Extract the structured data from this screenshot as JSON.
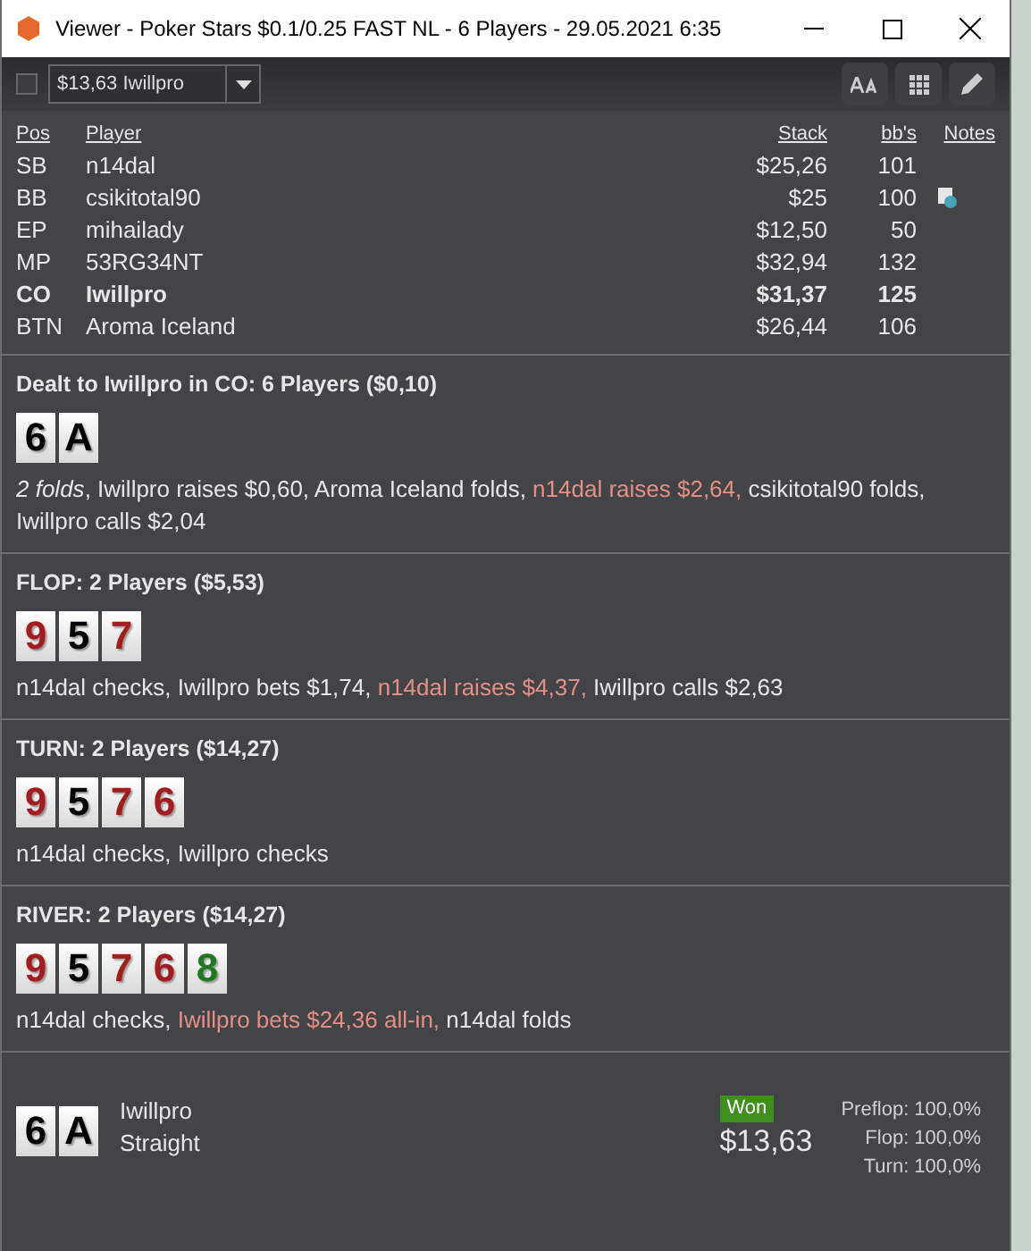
{
  "window": {
    "title": "Viewer - Poker Stars $0.1/0.25 FAST NL - 6 Players - 29.05.2021 6:35"
  },
  "toolbar": {
    "checked": false,
    "dropdown_value": "$13,63 Iwillpro"
  },
  "players": {
    "columns": [
      "Pos",
      "Player",
      "Stack",
      "bb's",
      "Notes"
    ],
    "rows": [
      {
        "pos": "SB",
        "player": "n14dal",
        "stack": "$25,26",
        "bbs": "101",
        "hero": false,
        "note": false
      },
      {
        "pos": "BB",
        "player": "csikitotal90",
        "stack": "$25",
        "bbs": "100",
        "hero": false,
        "note": true
      },
      {
        "pos": "EP",
        "player": "mihailady",
        "stack": "$12,50",
        "bbs": "50",
        "hero": false,
        "note": false
      },
      {
        "pos": "MP",
        "player": "53RG34NT",
        "stack": "$32,94",
        "bbs": "132",
        "hero": false,
        "note": false
      },
      {
        "pos": "CO",
        "player": "Iwillpro",
        "stack": "$31,37",
        "bbs": "125",
        "hero": true,
        "note": false
      },
      {
        "pos": "BTN",
        "player": "Aroma Iceland",
        "stack": "$26,44",
        "bbs": "106",
        "hero": false,
        "note": false
      }
    ]
  },
  "streets": [
    {
      "title": "Dealt to Iwillpro in CO: 6 Players ($0,10)",
      "cards": [
        {
          "rank": "6",
          "color": "#000000"
        },
        {
          "rank": "A",
          "color": "#000000"
        }
      ],
      "actions": [
        {
          "text": "2 folds",
          "kind": "italic"
        },
        {
          "text": ", Iwillpro raises $0,60, Aroma Iceland folds, ",
          "kind": "plain"
        },
        {
          "text": "n14dal raises $2,64,",
          "kind": "aggressive"
        },
        {
          "text": " csikitotal90 folds, Iwillpro calls $2,04",
          "kind": "plain"
        }
      ]
    },
    {
      "title": "FLOP: 2 Players ($5,53)",
      "cards": [
        {
          "rank": "9",
          "color": "#a51c1c"
        },
        {
          "rank": "5",
          "color": "#000000"
        },
        {
          "rank": "7",
          "color": "#a51c1c"
        }
      ],
      "actions": [
        {
          "text": "n14dal checks, Iwillpro bets $1,74, ",
          "kind": "plain"
        },
        {
          "text": "n14dal raises $4,37,",
          "kind": "aggressive"
        },
        {
          "text": " Iwillpro calls $2,63",
          "kind": "plain"
        }
      ]
    },
    {
      "title": "TURN: 2 Players ($14,27)",
      "cards": [
        {
          "rank": "9",
          "color": "#a51c1c"
        },
        {
          "rank": "5",
          "color": "#000000"
        },
        {
          "rank": "7",
          "color": "#a51c1c"
        },
        {
          "rank": "6",
          "color": "#a51c1c"
        }
      ],
      "actions": [
        {
          "text": "n14dal checks, Iwillpro checks",
          "kind": "plain"
        }
      ]
    },
    {
      "title": "RIVER: 2 Players ($14,27)",
      "cards": [
        {
          "rank": "9",
          "color": "#a51c1c"
        },
        {
          "rank": "5",
          "color": "#000000"
        },
        {
          "rank": "7",
          "color": "#a51c1c"
        },
        {
          "rank": "6",
          "color": "#a51c1c"
        },
        {
          "rank": "8",
          "color": "#1f7a1f"
        }
      ],
      "actions": [
        {
          "text": "n14dal checks, ",
          "kind": "plain"
        },
        {
          "text": "Iwillpro bets $24,36 all-in,",
          "kind": "aggressive"
        },
        {
          "text": " n14dal folds",
          "kind": "plain"
        }
      ]
    }
  ],
  "result": {
    "cards": [
      {
        "rank": "6",
        "color": "#000000"
      },
      {
        "rank": "A",
        "color": "#000000"
      }
    ],
    "player": "Iwillpro",
    "hand": "Straight",
    "badge": "Won",
    "amount": "$13,63",
    "equity": [
      "Preflop: 100,0%",
      "Flop: 100,0%",
      "Turn: 100,0%"
    ]
  }
}
